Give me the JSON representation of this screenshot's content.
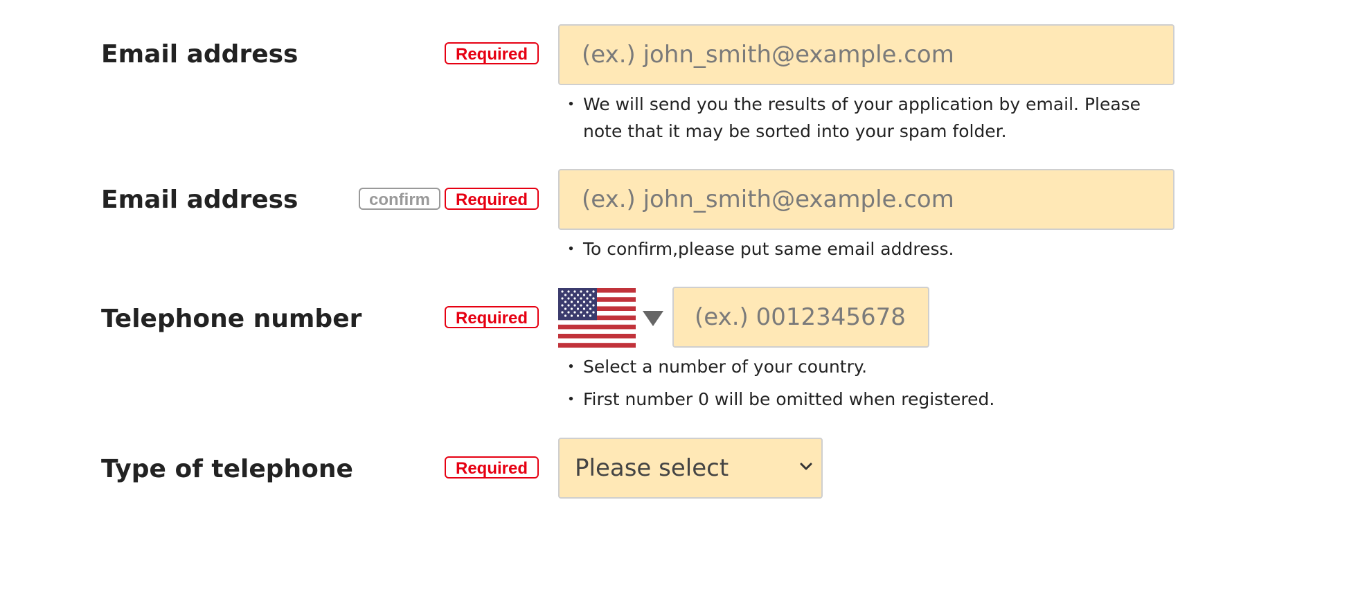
{
  "rows": {
    "email": {
      "label": "Email address",
      "required": "Required",
      "placeholder": "(ex.) john_smith@example.com",
      "note": "We will send you the results of your application by email. Please note that it may be sorted into your spam folder."
    },
    "email_confirm": {
      "label": "Email address",
      "confirm": "confirm",
      "required": "Required",
      "placeholder": "(ex.) john_smith@example.com",
      "note": "To confirm,please put same email address."
    },
    "telephone": {
      "label": "Telephone number",
      "required": "Required",
      "country_flag": "us-flag-icon",
      "placeholder": "(ex.) 0012345678",
      "notes": [
        "Select a number of your country.",
        "First number 0 will be omitted when registered."
      ]
    },
    "telephone_type": {
      "label": "Type of telephone",
      "required": "Required",
      "selected": "Please select"
    }
  },
  "colors": {
    "required": "#e60012",
    "field_bg": "#ffe8b6",
    "confirm": "#999999"
  }
}
